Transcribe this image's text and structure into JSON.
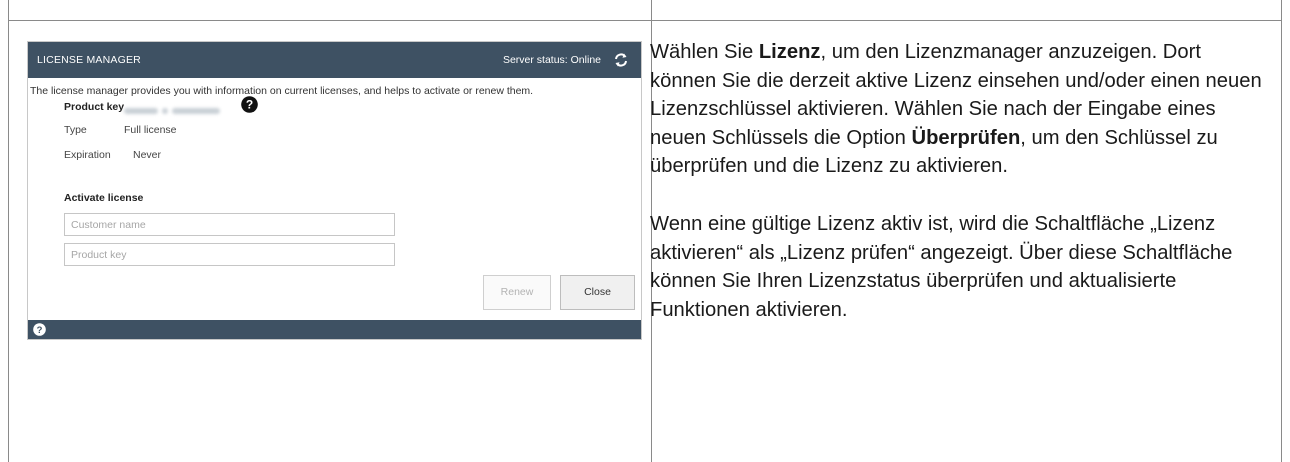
{
  "dialog": {
    "title": "LICENSE MANAGER",
    "server_status": "Server status: Online",
    "intro": "The license manager provides you with information on current licenses, and helps to activate or renew them.",
    "product_key_label": "Product key",
    "type_label": "Type",
    "type_value": "Full license",
    "expiration_label": "Expiration",
    "expiration_value": "Never",
    "activate_heading": "Activate license",
    "customer_name_placeholder": "Customer name",
    "product_key_placeholder": "Product key",
    "renew_label": "Renew",
    "close_label": "Close",
    "colors": {
      "titlebar": "#3e5163",
      "footer": "#3e5163"
    },
    "icons": [
      "refresh-icon",
      "help-icon"
    ]
  },
  "text": {
    "p1_a": "Wählen Sie ",
    "p1_b": "Lizenz",
    "p1_c": ", um den Lizenzmanager anzuzeigen. Dort können Sie die derzeit aktive Lizenz einsehen und/oder einen neuen Lizenzschlüssel aktivieren. Wählen Sie nach der Eingabe eines neuen Schlüssels die Option ",
    "p1_d": "Überprüfen",
    "p1_e": ", um den Schlüssel zu überprüfen und die Lizenz zu aktivieren.",
    "p2": "Wenn eine gültige Lizenz aktiv ist, wird die Schaltfläche „Lizenz aktivieren“ als „Lizenz prüfen“ angezeigt. Über diese Schaltfläche können Sie Ihren Lizenzstatus überprüfen und aktualisierte Funktionen aktivieren."
  }
}
